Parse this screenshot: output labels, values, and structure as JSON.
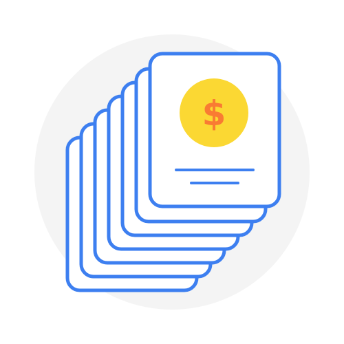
{
  "icon": {
    "name": "invoice-stack-icon",
    "coin_symbol": "$"
  },
  "colors": {
    "background": "#ffffff",
    "circle": "#f4f4f4",
    "outline": "#3d7ff0",
    "paper": "#ffffff",
    "coin": "#fbd833",
    "symbol": "#f97b33"
  }
}
